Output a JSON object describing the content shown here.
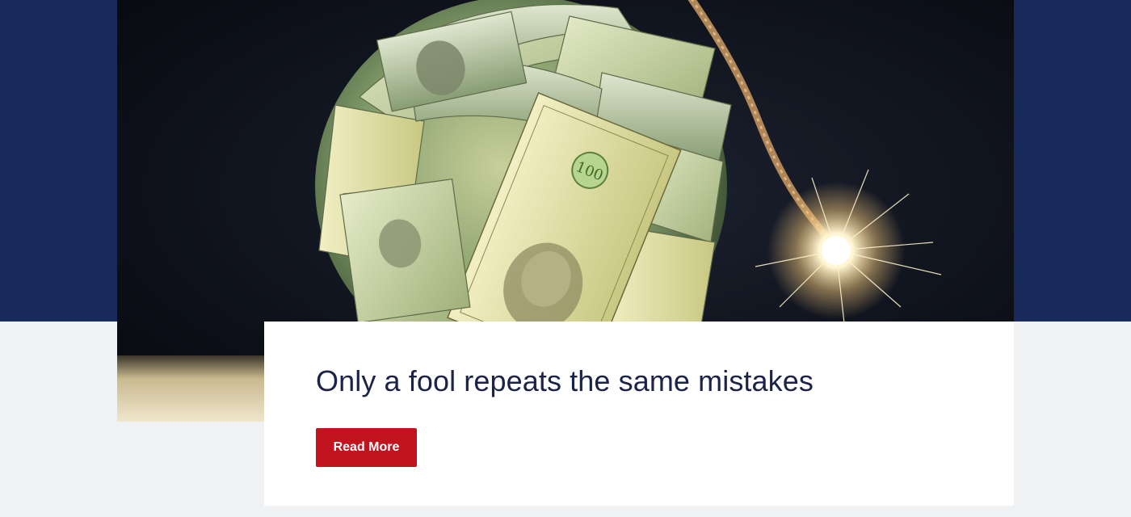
{
  "hero": {
    "image_alt": "Bomb made of rolled hundred-dollar bills with a lit fuse"
  },
  "article": {
    "title": "Only a fool repeats the same mistakes",
    "read_more_label": "Read More"
  },
  "colors": {
    "band": "#182a5c",
    "page_background": "#f0f1f3",
    "card_background": "#ffffff",
    "title_text": "#1b2448",
    "button": "#c2141f",
    "button_text": "#ffffff"
  }
}
